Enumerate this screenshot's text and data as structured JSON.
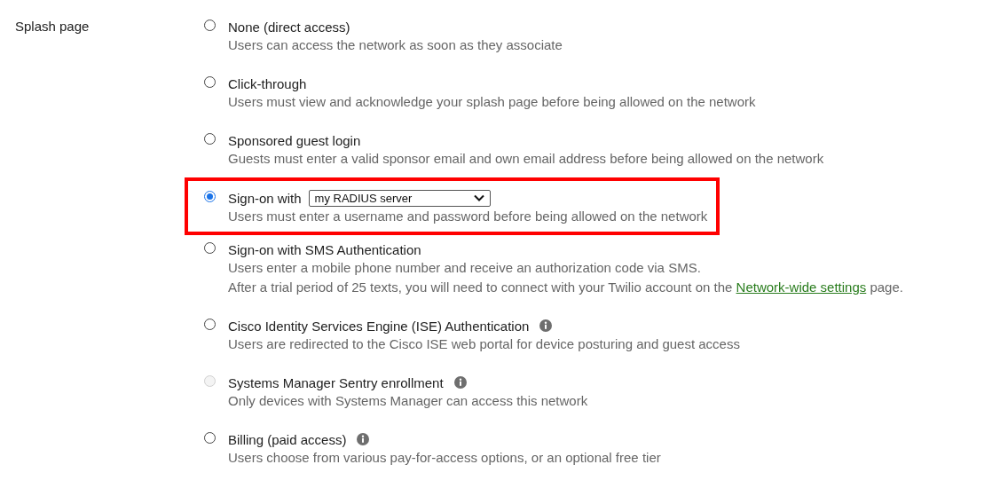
{
  "field_label": "Splash page",
  "options": [
    {
      "label": "None (direct access)",
      "selected": false,
      "disabled": false,
      "info": false,
      "highlighted": false,
      "description": [
        [
          {
            "kind": "text",
            "text": "Users can access the network as soon as they associate"
          }
        ]
      ]
    },
    {
      "label": "Click-through",
      "selected": false,
      "disabled": false,
      "info": false,
      "highlighted": false,
      "description": [
        [
          {
            "kind": "text",
            "text": "Users must view and acknowledge your splash page before being allowed on the network"
          }
        ]
      ]
    },
    {
      "label": "Sponsored guest login",
      "selected": false,
      "disabled": false,
      "info": false,
      "highlighted": false,
      "description": [
        [
          {
            "kind": "text",
            "text": "Guests must enter a valid sponsor email and own email address before being allowed on the network"
          }
        ]
      ]
    },
    {
      "label": "Sign-on with",
      "select": "my RADIUS server",
      "selected": true,
      "disabled": false,
      "info": false,
      "highlighted": true,
      "description": [
        [
          {
            "kind": "text",
            "text": "Users must enter a username and password before being allowed on the network"
          }
        ]
      ]
    },
    {
      "label": "Sign-on with SMS Authentication",
      "selected": false,
      "disabled": false,
      "info": false,
      "highlighted": false,
      "description": [
        [
          {
            "kind": "text",
            "text": "Users enter a mobile phone number and receive an authorization code via SMS."
          }
        ],
        [
          {
            "kind": "text",
            "text": "After a trial period of 25 texts, you will need to connect with your Twilio account on the "
          },
          {
            "kind": "link",
            "text": "Network-wide settings"
          },
          {
            "kind": "text",
            "text": " page."
          }
        ]
      ]
    },
    {
      "label": "Cisco Identity Services Engine (ISE) Authentication",
      "selected": false,
      "disabled": false,
      "info": true,
      "highlighted": false,
      "description": [
        [
          {
            "kind": "text",
            "text": "Users are redirected to the Cisco ISE web portal for device posturing and guest access"
          }
        ]
      ]
    },
    {
      "label": "Systems Manager Sentry enrollment",
      "selected": false,
      "disabled": true,
      "info": true,
      "highlighted": false,
      "description": [
        [
          {
            "kind": "text",
            "text": "Only devices with Systems Manager can access this network"
          }
        ]
      ]
    },
    {
      "label": "Billing (paid access)",
      "selected": false,
      "disabled": false,
      "info": true,
      "highlighted": false,
      "description": [
        [
          {
            "kind": "text",
            "text": "Users choose from various pay-for-access options, or an optional free tier"
          }
        ]
      ]
    }
  ]
}
